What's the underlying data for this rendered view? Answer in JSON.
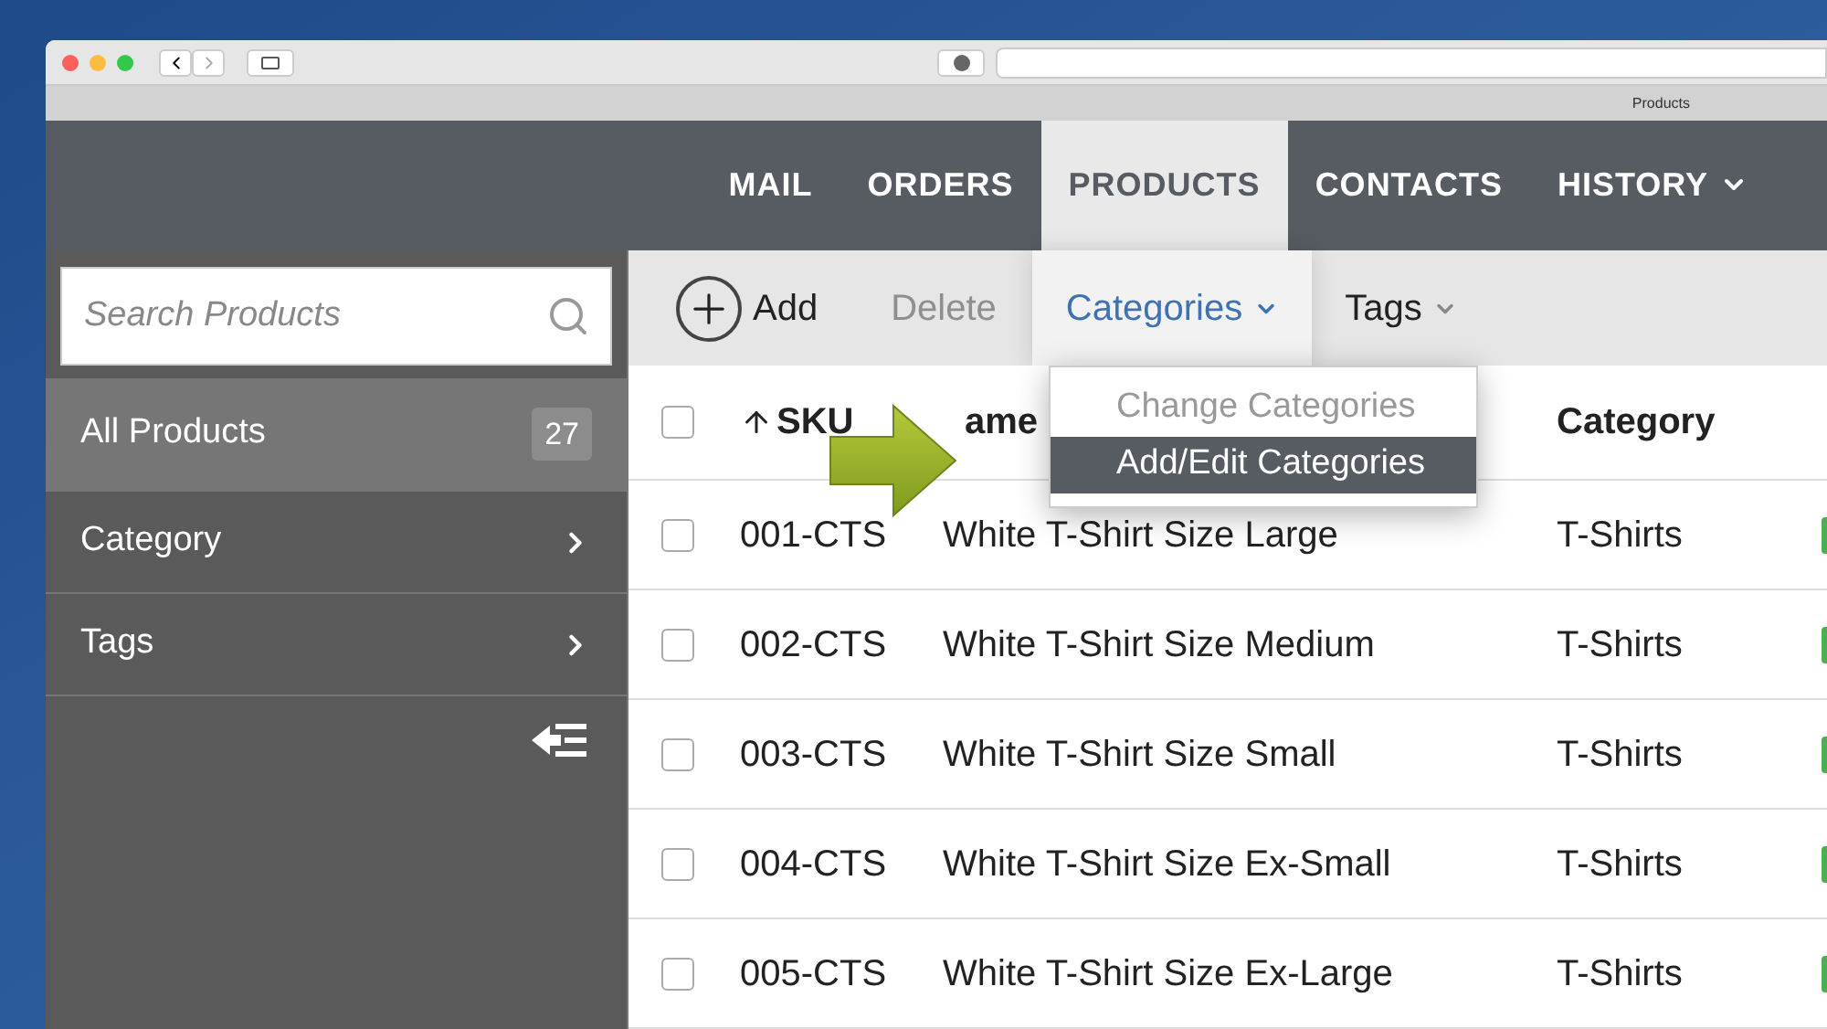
{
  "browser": {
    "tab_title": "Products"
  },
  "nav": [
    {
      "label": "MAIL",
      "selected": false,
      "caret": false
    },
    {
      "label": "ORDERS",
      "selected": false,
      "caret": false
    },
    {
      "label": "PRODUCTS",
      "selected": true,
      "caret": false
    },
    {
      "label": "CONTACTS",
      "selected": false,
      "caret": false
    },
    {
      "label": "HISTORY",
      "selected": false,
      "caret": true
    }
  ],
  "sidebar": {
    "search": {
      "placeholder": "Search Products"
    },
    "items": [
      {
        "label": "All Products",
        "count": "27",
        "selected": true,
        "kind": "count"
      },
      {
        "label": "Category",
        "selected": false,
        "kind": "arrow"
      },
      {
        "label": "Tags",
        "selected": false,
        "kind": "arrow"
      }
    ]
  },
  "toolbar": [
    {
      "kind": "add",
      "label": "Add",
      "disabled": false,
      "open": false
    },
    {
      "kind": "plain",
      "label": "Delete",
      "disabled": true,
      "open": false
    },
    {
      "kind": "dropdown",
      "label": "Categories",
      "disabled": false,
      "open": true
    },
    {
      "kind": "dropdown",
      "label": "Tags",
      "disabled": false,
      "open": false
    }
  ],
  "menu": [
    {
      "label": "Change Categories",
      "disabled": true,
      "selected": false
    },
    {
      "label": "Add/Edit Categories",
      "disabled": false,
      "selected": true
    }
  ],
  "table": {
    "select_all_checked": false,
    "columns": [
      "SKU",
      "ame",
      "Category"
    ],
    "rows": [
      {
        "checked": false,
        "cells": [
          "001-CTS",
          "White T-Shirt Size Large",
          "T-Shirts"
        ]
      },
      {
        "checked": false,
        "cells": [
          "002-CTS",
          "White T-Shirt Size Medium",
          "T-Shirts"
        ]
      },
      {
        "checked": false,
        "cells": [
          "003-CTS",
          "White T-Shirt Size Small",
          "T-Shirts"
        ]
      },
      {
        "checked": false,
        "cells": [
          "004-CTS",
          "White T-Shirt Size Ex-Small",
          "T-Shirts"
        ]
      },
      {
        "checked": false,
        "cells": [
          "005-CTS",
          "White T-Shirt Size Ex-Large",
          "T-Shirts"
        ]
      }
    ]
  }
}
